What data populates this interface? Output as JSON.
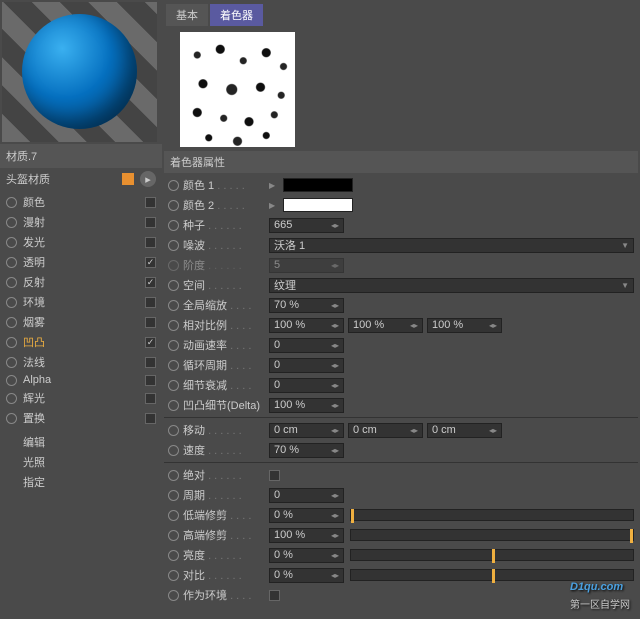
{
  "material": {
    "name": "材质.7",
    "header": "头盔材质"
  },
  "channels": [
    {
      "label": "颜色",
      "checked": false,
      "active": false
    },
    {
      "label": "漫射",
      "checked": false,
      "active": false
    },
    {
      "label": "发光",
      "checked": false,
      "active": false
    },
    {
      "label": "透明",
      "checked": true,
      "active": false
    },
    {
      "label": "反射",
      "checked": true,
      "active": false
    },
    {
      "label": "环境",
      "checked": false,
      "active": false
    },
    {
      "label": "烟雾",
      "checked": false,
      "active": false
    },
    {
      "label": "凹凸",
      "checked": true,
      "active": true
    },
    {
      "label": "法线",
      "checked": false,
      "active": false
    },
    {
      "label": "Alpha",
      "checked": false,
      "active": false
    },
    {
      "label": "辉光",
      "checked": false,
      "active": false
    },
    {
      "label": "置换",
      "checked": false,
      "active": false
    }
  ],
  "extra_items": [
    "编辑",
    "光照",
    "指定"
  ],
  "tabs": [
    {
      "label": "基本"
    },
    {
      "label": "着色器"
    }
  ],
  "section_title": "着色器属性",
  "props": {
    "color1": {
      "label": "颜色 1"
    },
    "color2": {
      "label": "颜色 2"
    },
    "seed": {
      "label": "种子",
      "value": "665"
    },
    "noise": {
      "label": "噪波",
      "value": "沃洛 1"
    },
    "octaves": {
      "label": "阶度",
      "value": "5"
    },
    "space": {
      "label": "空间",
      "value": "纹理"
    },
    "global_scale": {
      "label": "全局缩放",
      "value": "70 %"
    },
    "relative_scale": {
      "label": "相对比例",
      "v1": "100 %",
      "v2": "100 %",
      "v3": "100 %"
    },
    "anim_speed": {
      "label": "动画速率",
      "value": "0"
    },
    "loop_period": {
      "label": "循环周期",
      "value": "0"
    },
    "detail_atten": {
      "label": "细节衰减",
      "value": "0"
    },
    "delta": {
      "label": "凹凸细节(Delta)",
      "value": "100 %"
    },
    "movement": {
      "label": "移动",
      "v1": "0 cm",
      "v2": "0 cm",
      "v3": "0 cm"
    },
    "speed": {
      "label": "速度",
      "value": "70 %"
    },
    "absolute": {
      "label": "绝对"
    },
    "cycles": {
      "label": "周期",
      "value": "0"
    },
    "low_clip": {
      "label": "低端修剪",
      "value": "0 %",
      "handle": 0
    },
    "high_clip": {
      "label": "高端修剪",
      "value": "100 %",
      "handle": 100
    },
    "brightness": {
      "label": "亮度",
      "value": "0 %",
      "handle": 50
    },
    "contrast": {
      "label": "对比",
      "value": "0 %",
      "handle": 50
    },
    "as_env": {
      "label": "作为环境"
    }
  },
  "watermark": {
    "main": "D1qu.com",
    "sub": "第一区自学网"
  }
}
